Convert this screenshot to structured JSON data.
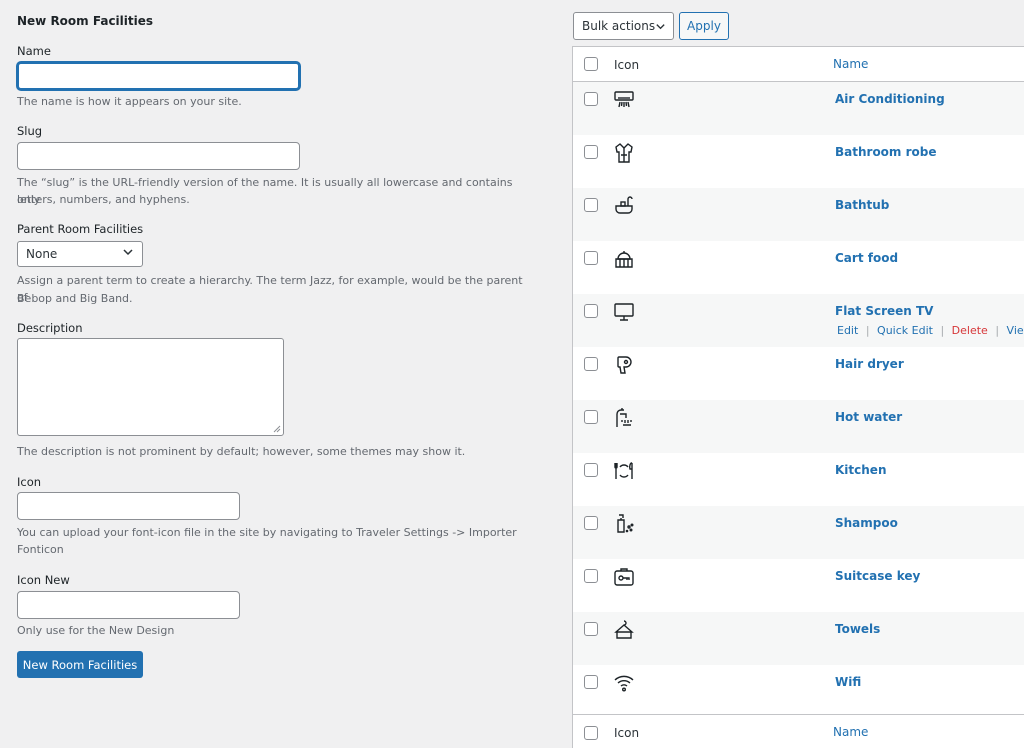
{
  "form": {
    "title": "New Room Facilities",
    "name_label": "Name",
    "name_value": "",
    "name_hint": "The name is how it appears on your site.",
    "slug_label": "Slug",
    "slug_value": "",
    "slug_hint_1": "The “slug” is the URL-friendly version of the name. It is usually all lowercase and contains only",
    "slug_hint_2": "letters, numbers, and hyphens.",
    "parent_label": "Parent Room Facilities",
    "parent_selected": "None",
    "parent_hint_1": "Assign a parent term to create a hierarchy. The term Jazz, for example, would be the parent of",
    "parent_hint_2": "Bebop and Big Band.",
    "description_label": "Description",
    "description_value": "",
    "description_hint": "The description is not prominent by default; however, some themes may show it.",
    "icon_label": "Icon",
    "icon_value": "",
    "icon_hint_1": "You can upload your font-icon file in the site by navigating to Traveler Settings -> Importer",
    "icon_hint_2": "Fonticon",
    "icon_new_label": "Icon New",
    "icon_new_value": "",
    "icon_new_hint": "Only use for the New Design",
    "submit_label": "New Room Facilities"
  },
  "bulk": {
    "selected": "Bulk actions",
    "apply_label": "Apply"
  },
  "table": {
    "col_icon": "Icon",
    "col_name": "Name",
    "rows": [
      {
        "name": "Air Conditioning",
        "icon": "air-conditioner-icon"
      },
      {
        "name": "Bathroom robe",
        "icon": "bathrobe-icon"
      },
      {
        "name": "Bathtub",
        "icon": "bathtub-icon"
      },
      {
        "name": "Cart food",
        "icon": "food-cart-icon"
      },
      {
        "name": "Flat Screen TV",
        "icon": "tv-monitor-icon"
      },
      {
        "name": "Hair dryer",
        "icon": "hair-dryer-icon"
      },
      {
        "name": "Hot water",
        "icon": "hot-water-icon"
      },
      {
        "name": "Kitchen",
        "icon": "kitchen-icon"
      },
      {
        "name": "Shampoo",
        "icon": "shampoo-icon"
      },
      {
        "name": "Suitcase key",
        "icon": "suitcase-key-icon"
      },
      {
        "name": "Towels",
        "icon": "towels-icon"
      },
      {
        "name": "Wifi",
        "icon": "wifi-icon"
      }
    ],
    "row_actions": {
      "edit": "Edit",
      "quick_edit": "Quick Edit",
      "delete": "Delete",
      "view": "View",
      "separator": "|"
    }
  },
  "colors": {
    "link": "#2271b1",
    "delete": "#d63638",
    "background": "#f0f0f1"
  }
}
